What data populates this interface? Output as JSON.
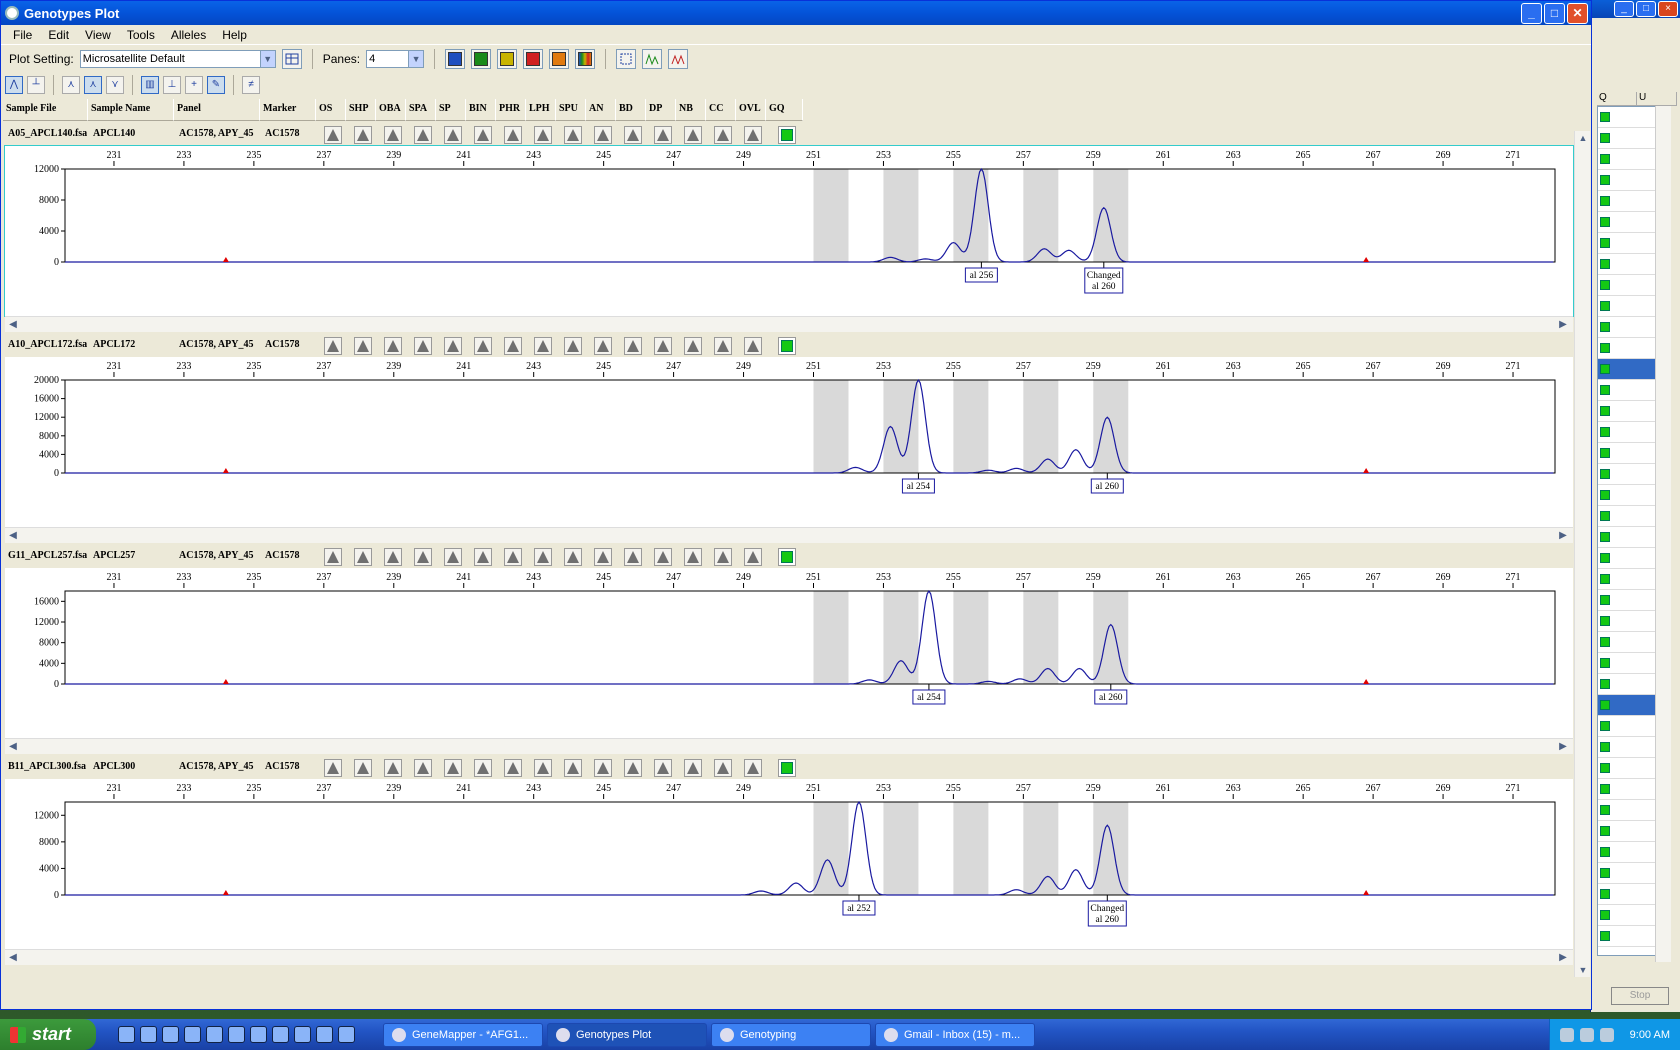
{
  "window": {
    "title": "Genotypes Plot"
  },
  "menu": [
    "File",
    "Edit",
    "View",
    "Tools",
    "Alleles",
    "Help"
  ],
  "toolbar": {
    "plot_setting_label": "Plot Setting:",
    "plot_setting_value": "Microsatellite Default",
    "panes_label": "Panes:",
    "panes_value": "4",
    "dye_colors": [
      "#1f4fbf",
      "#1a8a1a",
      "#c8b400",
      "#d02020",
      "#e07a10",
      "#1f7a3a"
    ]
  },
  "columns": [
    "Sample File",
    "Sample Name",
    "Panel",
    "Marker",
    "OS",
    "SHP",
    "OBA",
    "SPA",
    "SP",
    "BIN",
    "PHR",
    "LPH",
    "SPU",
    "AN",
    "BD",
    "DP",
    "NB",
    "CC",
    "OVL",
    "GQ"
  ],
  "x_ticks": [
    "231",
    "233",
    "235",
    "237",
    "239",
    "241",
    "243",
    "245",
    "247",
    "249",
    "251",
    "253",
    "255",
    "257",
    "259",
    "261",
    "263",
    "265",
    "267",
    "269",
    "271"
  ],
  "panes": [
    {
      "sample_file": "A05_APCL140.fsa",
      "sample_name": "APCL140",
      "panel": "AC1578, APY_45",
      "marker": "AC1578",
      "y_ticks": [
        "12000",
        "8000",
        "4000",
        "0"
      ],
      "y_max": 12000,
      "peaks": [
        [
          253.2,
          600
        ],
        [
          254.2,
          400
        ],
        [
          255.0,
          2500
        ],
        [
          255.8,
          12000
        ],
        [
          257.6,
          1700
        ],
        [
          258.3,
          1500
        ],
        [
          259.3,
          7000
        ]
      ],
      "labels": [
        {
          "x": 255.8,
          "lines": [
            "al 256"
          ]
        },
        {
          "x": 259.3,
          "lines": [
            "Changed",
            "al 260"
          ]
        }
      ]
    },
    {
      "sample_file": "A10_APCL172.fsa",
      "sample_name": "APCL172",
      "panel": "AC1578, APY_45",
      "marker": "AC1578",
      "y_ticks": [
        "20000",
        "16000",
        "12000",
        "8000",
        "4000",
        "0"
      ],
      "y_max": 20000,
      "peaks": [
        [
          252.2,
          1200
        ],
        [
          253.2,
          10000
        ],
        [
          254.0,
          20000
        ],
        [
          256.0,
          600
        ],
        [
          256.8,
          1000
        ],
        [
          257.7,
          3000
        ],
        [
          258.5,
          5000
        ],
        [
          259.4,
          12000
        ]
      ],
      "labels": [
        {
          "x": 254.0,
          "lines": [
            "al 254"
          ]
        },
        {
          "x": 259.4,
          "lines": [
            "al 260"
          ]
        }
      ]
    },
    {
      "sample_file": "G11_APCL257.fsa",
      "sample_name": "APCL257",
      "panel": "AC1578, APY_45",
      "marker": "AC1578",
      "y_ticks": [
        "16000",
        "12000",
        "8000",
        "4000",
        "0"
      ],
      "y_max": 18000,
      "peaks": [
        [
          252.6,
          800
        ],
        [
          253.5,
          4500
        ],
        [
          254.3,
          18000
        ],
        [
          256.0,
          500
        ],
        [
          256.9,
          1000
        ],
        [
          257.7,
          3000
        ],
        [
          258.6,
          3000
        ],
        [
          259.5,
          11500
        ]
      ],
      "labels": [
        {
          "x": 254.3,
          "lines": [
            "al 254"
          ]
        },
        {
          "x": 259.5,
          "lines": [
            "al 260"
          ]
        }
      ]
    },
    {
      "sample_file": "B11_APCL300.fsa",
      "sample_name": "APCL300",
      "panel": "AC1578, APY_45",
      "marker": "AC1578",
      "y_ticks": [
        "12000",
        "8000",
        "4000",
        "0"
      ],
      "y_max": 14000,
      "peaks": [
        [
          249.5,
          600
        ],
        [
          250.5,
          1800
        ],
        [
          251.4,
          5300
        ],
        [
          252.3,
          14000
        ],
        [
          256.8,
          800
        ],
        [
          257.7,
          2800
        ],
        [
          258.5,
          3800
        ],
        [
          259.4,
          10500
        ]
      ],
      "labels": [
        {
          "x": 252.3,
          "lines": [
            "al 252"
          ]
        },
        {
          "x": 259.4,
          "lines": [
            "Changed",
            "al 260"
          ]
        }
      ]
    }
  ],
  "bins": [
    251.5,
    253.5,
    255.5,
    257.5,
    259.5
  ],
  "ref_markers": [
    234.2,
    266.8
  ],
  "background_window": {
    "col_q": "Q",
    "col_u": "U",
    "stop_label": "Stop"
  },
  "taskbar": {
    "start": "start",
    "tasks": [
      "GeneMapper - *AFG1...",
      "Genotypes Plot",
      "Genotyping",
      "Gmail - Inbox (15) - m..."
    ],
    "clock": "9:00 AM"
  }
}
